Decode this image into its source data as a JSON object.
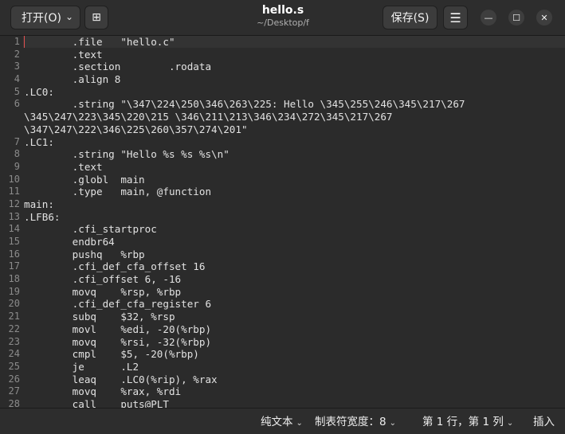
{
  "header": {
    "open_label": "打开(O)",
    "open_chevron": "⌄",
    "new_tab_icon": "⊞",
    "title": "hello.s",
    "subtitle": "~/Desktop/f",
    "save_label": "保存(S)",
    "menu_icon": "☰",
    "minimize_icon": "—",
    "maximize_icon": "☐",
    "close_icon": "✕"
  },
  "editor": {
    "lines": [
      {
        "n": "1",
        "t": "        .file   \"hello.c\""
      },
      {
        "n": "2",
        "t": "        .text"
      },
      {
        "n": "3",
        "t": "        .section        .rodata"
      },
      {
        "n": "4",
        "t": "        .align 8"
      },
      {
        "n": "5",
        "t": ".LC0:"
      },
      {
        "n": "6",
        "t": "        .string \"\\347\\224\\250\\346\\263\\225: Hello \\345\\255\\246\\345\\217\\267"
      },
      {
        "n": "",
        "t": "\\345\\247\\223\\345\\220\\215 \\346\\211\\213\\346\\234\\272\\345\\217\\267"
      },
      {
        "n": "",
        "t": "\\347\\247\\222\\346\\225\\260\\357\\274\\201\""
      },
      {
        "n": "7",
        "t": ".LC1:"
      },
      {
        "n": "8",
        "t": "        .string \"Hello %s %s %s\\n\""
      },
      {
        "n": "9",
        "t": "        .text"
      },
      {
        "n": "10",
        "t": "        .globl  main"
      },
      {
        "n": "11",
        "t": "        .type   main, @function"
      },
      {
        "n": "12",
        "t": "main:"
      },
      {
        "n": "13",
        "t": ".LFB6:"
      },
      {
        "n": "14",
        "t": "        .cfi_startproc"
      },
      {
        "n": "15",
        "t": "        endbr64"
      },
      {
        "n": "16",
        "t": "        pushq   %rbp"
      },
      {
        "n": "17",
        "t": "        .cfi_def_cfa_offset 16"
      },
      {
        "n": "18",
        "t": "        .cfi_offset 6, -16"
      },
      {
        "n": "19",
        "t": "        movq    %rsp, %rbp"
      },
      {
        "n": "20",
        "t": "        .cfi_def_cfa_register 6"
      },
      {
        "n": "21",
        "t": "        subq    $32, %rsp"
      },
      {
        "n": "22",
        "t": "        movl    %edi, -20(%rbp)"
      },
      {
        "n": "23",
        "t": "        movq    %rsi, -32(%rbp)"
      },
      {
        "n": "24",
        "t": "        cmpl    $5, -20(%rbp)"
      },
      {
        "n": "25",
        "t": "        je      .L2"
      },
      {
        "n": "26",
        "t": "        leaq    .LC0(%rip), %rax"
      },
      {
        "n": "27",
        "t": "        movq    %rax, %rdi"
      },
      {
        "n": "28",
        "t": "        call    puts@PLT"
      }
    ]
  },
  "statusbar": {
    "language": "纯文本",
    "tab_width": "制表符宽度：8",
    "position": "第 1 行，第 1 列",
    "insert_mode": "插入",
    "chevron": "⌄"
  },
  "colors": {
    "background": "#2b2b2b",
    "text": "#e2e2e2",
    "line_number": "#8b8b8b",
    "caret": "#e05050"
  }
}
